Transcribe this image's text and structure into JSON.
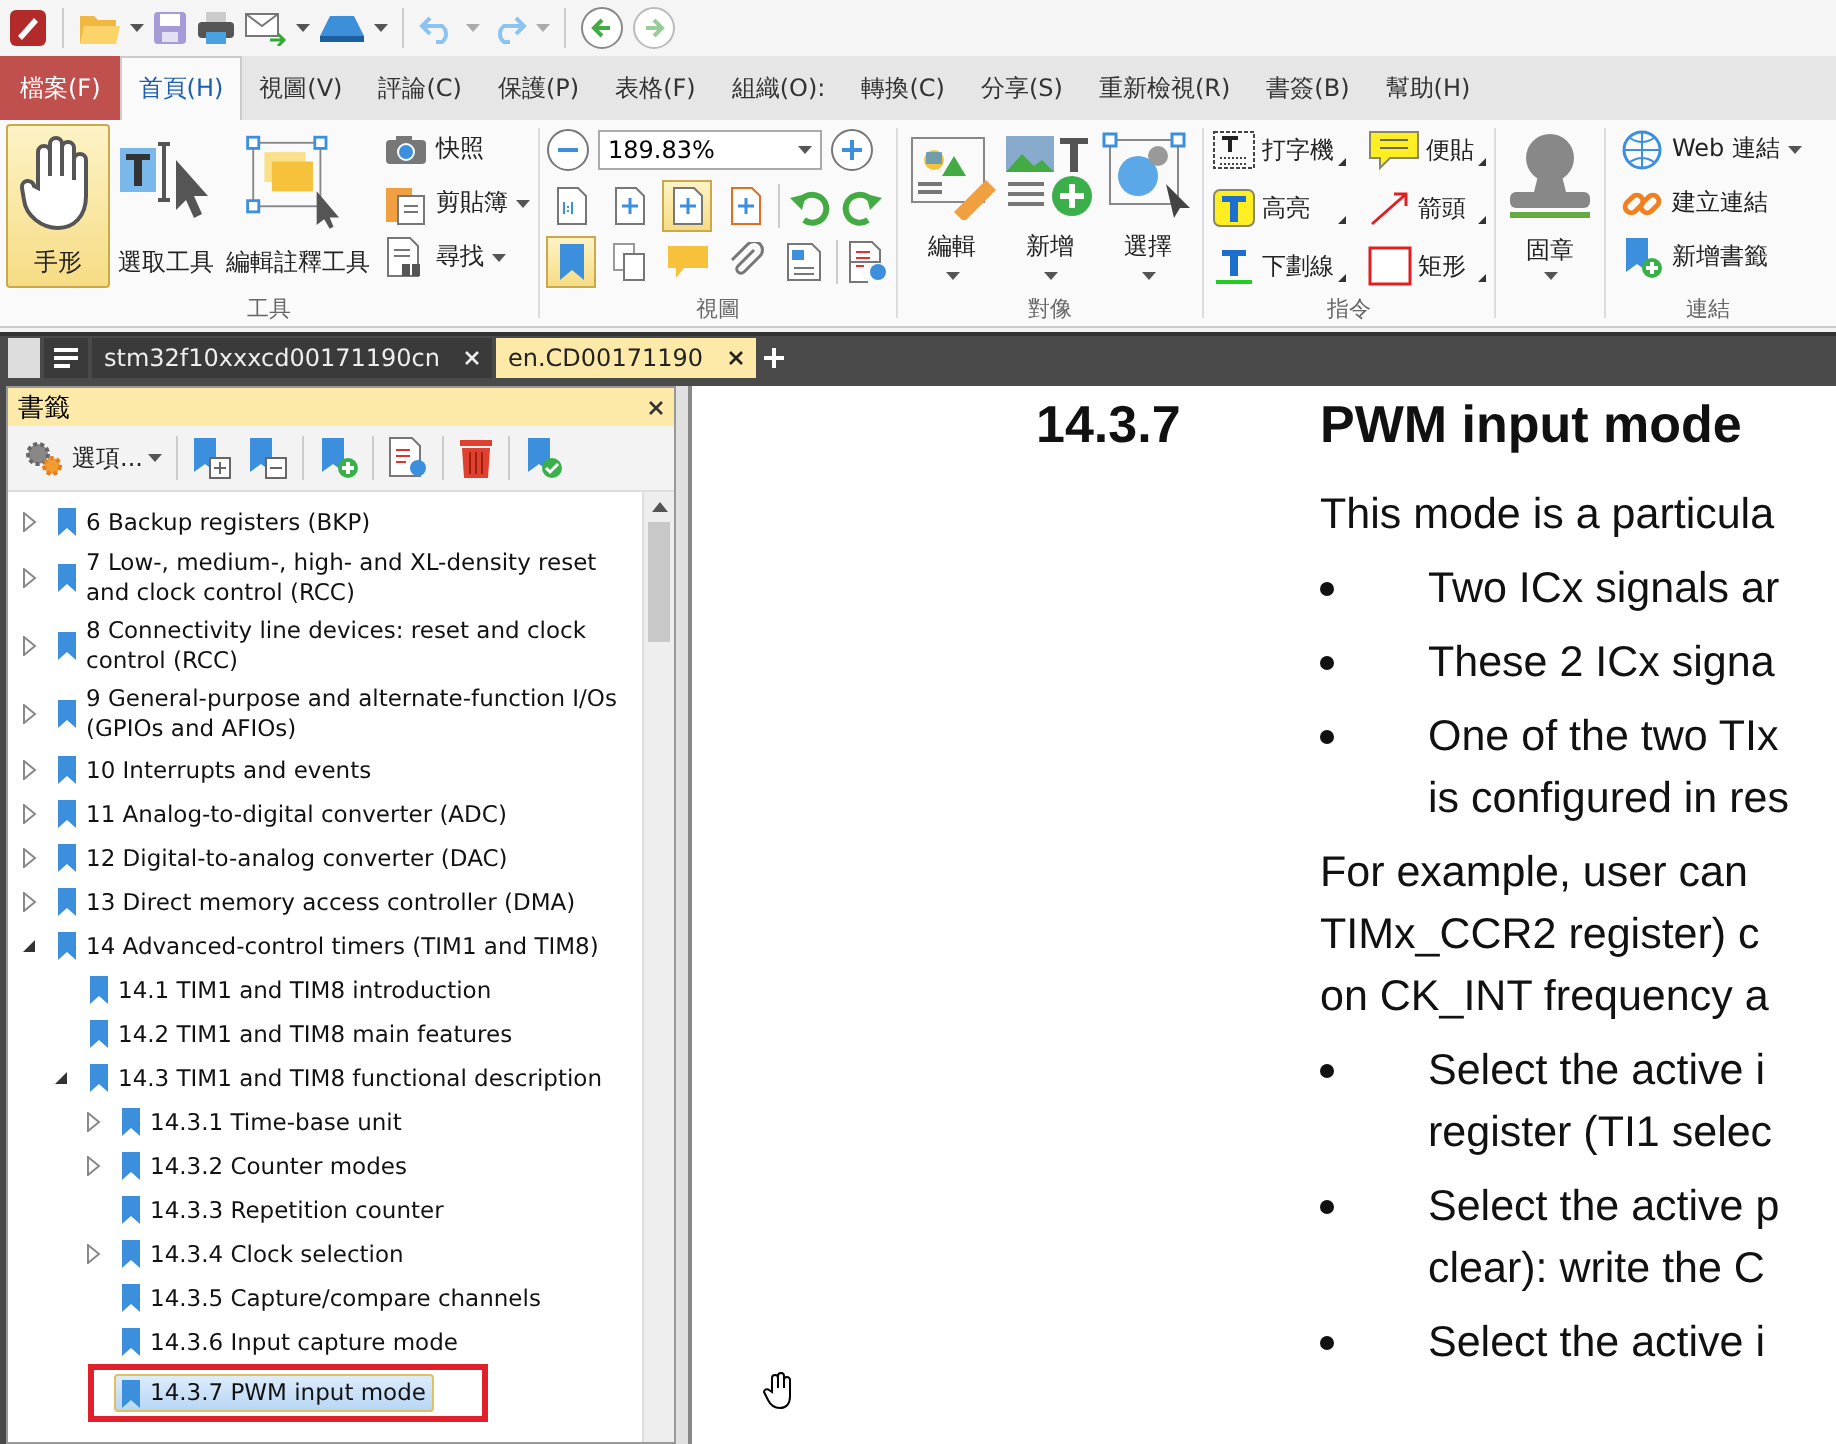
{
  "menu_tabs": [
    {
      "label": "檔案(F)",
      "kind": "file",
      "selected": false
    },
    {
      "label": "首頁(H)",
      "kind": "tab",
      "selected": true
    },
    {
      "label": "視圖(V)",
      "kind": "tab",
      "selected": false
    },
    {
      "label": "評論(C)",
      "kind": "tab",
      "selected": false
    },
    {
      "label": "保護(P)",
      "kind": "tab",
      "selected": false
    },
    {
      "label": "表格(F)",
      "kind": "tab",
      "selected": false
    },
    {
      "label": "組織(O):",
      "kind": "tab",
      "selected": false
    },
    {
      "label": "轉換(C)",
      "kind": "tab",
      "selected": false
    },
    {
      "label": "分享(S)",
      "kind": "tab",
      "selected": false
    },
    {
      "label": "重新檢視(R)",
      "kind": "tab",
      "selected": false
    },
    {
      "label": "書簽(B)",
      "kind": "tab",
      "selected": false
    },
    {
      "label": "幫助(H)",
      "kind": "tab",
      "selected": false
    }
  ],
  "ribbon": {
    "tools": {
      "label": "工具",
      "big": [
        {
          "label": "手形",
          "selected": true
        },
        {
          "label": "選取工具",
          "selected": false
        },
        {
          "label": "編輯註釋工具",
          "selected": false
        }
      ],
      "small": [
        {
          "label": "快照",
          "dropdown": false
        },
        {
          "label": "剪貼簿",
          "dropdown": true
        },
        {
          "label": "尋找",
          "dropdown": true
        }
      ]
    },
    "view": {
      "label": "視圖",
      "zoom": "189.83%",
      "fit_buttons": [
        {
          "selected": false
        },
        {
          "selected": false
        },
        {
          "selected": true
        },
        {
          "selected": false
        }
      ],
      "panel_buttons": [
        {
          "selected": true
        },
        {
          "selected": false
        },
        {
          "selected": false
        },
        {
          "selected": false
        },
        {
          "selected": false
        }
      ]
    },
    "objects": {
      "label": "對像",
      "buttons": [
        {
          "label": "編輯"
        },
        {
          "label": "新增"
        },
        {
          "label": "選擇"
        }
      ]
    },
    "commands": {
      "label": "指令",
      "items": [
        {
          "label": "打字機"
        },
        {
          "label": "便貼"
        },
        {
          "label": "高亮"
        },
        {
          "label": "箭頭"
        },
        {
          "label": "下劃線"
        },
        {
          "label": "矩形"
        }
      ]
    },
    "stamp": {
      "label": "固章"
    },
    "links": {
      "label": "連結",
      "items": [
        {
          "label": "Web 連結",
          "dropdown": true
        },
        {
          "label": "建立連結",
          "dropdown": false
        },
        {
          "label": "新增書籤",
          "dropdown": false
        }
      ]
    }
  },
  "doc_tabs": [
    {
      "label": "stm32f10xxxcd00171190cn",
      "selected": false
    },
    {
      "label": "en.CD00171190",
      "selected": true
    }
  ],
  "bookmarks": {
    "title": "書籤",
    "options": "選項...",
    "items": [
      {
        "label": "6 Backup registers (BKP)",
        "expanded": false,
        "selected": false
      },
      {
        "label": "7 Low-, medium-, high- and XL-density reset and clock control (RCC)",
        "expanded": false,
        "selected": false
      },
      {
        "label": "8 Connectivity line devices: reset and clock control (RCC)",
        "expanded": false,
        "selected": false
      },
      {
        "label": "9 General-purpose and alternate-function I/Os (GPIOs and AFIOs)",
        "expanded": false,
        "selected": false
      },
      {
        "label": "10 Interrupts and events",
        "expanded": false,
        "selected": false
      },
      {
        "label": "11 Analog-to-digital converter (ADC)",
        "expanded": false,
        "selected": false
      },
      {
        "label": "12 Digital-to-analog converter (DAC)",
        "expanded": false,
        "selected": false
      },
      {
        "label": "13 Direct memory access controller (DMA)",
        "expanded": false,
        "selected": false
      },
      {
        "label": "14 Advanced-control timers (TIM1 and TIM8)",
        "expanded": true,
        "selected": false,
        "children": [
          {
            "label": "14.1 TIM1 and TIM8 introduction",
            "selected": false
          },
          {
            "label": "14.2 TIM1 and TIM8 main features",
            "selected": false
          },
          {
            "label": "14.3 TIM1 and TIM8 functional description",
            "expanded": true,
            "selected": false,
            "children": [
              {
                "label": "14.3.1 Time-base unit",
                "expanded": false,
                "selected": false
              },
              {
                "label": "14.3.2 Counter modes",
                "expanded": false,
                "selected": false
              },
              {
                "label": "14.3.3 Repetition counter",
                "selected": false
              },
              {
                "label": "14.3.4 Clock selection",
                "expanded": false,
                "selected": false
              },
              {
                "label": "14.3.5 Capture/compare channels",
                "selected": false
              },
              {
                "label": "14.3.6 Input capture mode",
                "selected": false
              },
              {
                "label": "14.3.7 PWM input mode",
                "selected": true
              }
            ]
          }
        ]
      }
    ]
  },
  "document": {
    "section_number": "14.3.7",
    "section_title": "PWM input mode",
    "blocks": [
      {
        "kind": "para",
        "lines": [
          "This mode is a particula"
        ]
      },
      {
        "kind": "bullet",
        "lines": [
          "Two ICx signals ar"
        ]
      },
      {
        "kind": "bullet",
        "lines": [
          "These 2 ICx signa"
        ]
      },
      {
        "kind": "bullet",
        "lines": [
          "One of the two TIx",
          "is configured in res"
        ]
      },
      {
        "kind": "para",
        "lines": [
          "For example, user can",
          "TIMx_CCR2 register) c",
          "on CK_INT frequency a"
        ]
      },
      {
        "kind": "bullet",
        "lines": [
          "Select the active i",
          "register (TI1 selec"
        ]
      },
      {
        "kind": "bullet",
        "lines": [
          "Select the active p",
          "clear): write the C"
        ]
      },
      {
        "kind": "bullet",
        "lines": [
          "Select the active i"
        ]
      }
    ]
  }
}
